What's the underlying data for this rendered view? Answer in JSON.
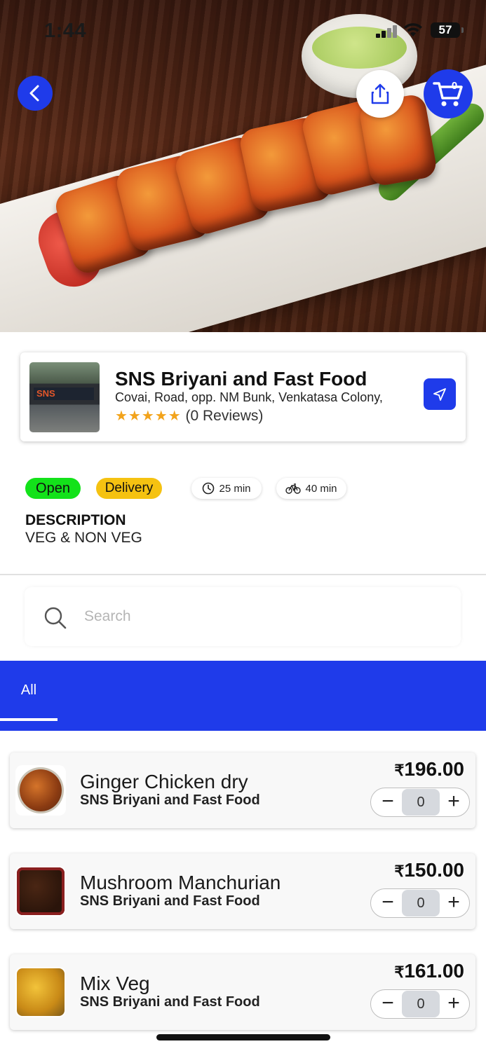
{
  "status": {
    "time": "1:44",
    "battery": "57"
  },
  "header": {
    "cart_count": "0"
  },
  "restaurant": {
    "name": "SNS Briyani and Fast Food",
    "address": "Covai, Road, opp. NM Bunk, Venkatasa Colony,",
    "stars": "★★★★★",
    "reviews": "(0 Reviews)",
    "thumb_sign": "SNS"
  },
  "tags": {
    "open": "Open",
    "delivery": "Delivery",
    "prep_time": "25 min",
    "ride_time": "40 min"
  },
  "description": {
    "title": "DESCRIPTION",
    "text": "VEG & NON VEG"
  },
  "search": {
    "placeholder": "Search"
  },
  "categories": [
    {
      "label": "All",
      "active": true
    }
  ],
  "items": [
    {
      "name": "Ginger Chicken dry",
      "restaurant": "SNS Briyani and Fast Food",
      "currency": "₹",
      "price": "196.00",
      "qty": "0"
    },
    {
      "name": "Mushroom Manchurian",
      "restaurant": "SNS Briyani and Fast Food",
      "currency": "₹",
      "price": "150.00",
      "qty": "0"
    },
    {
      "name": "Mix Veg",
      "restaurant": "SNS Briyani and Fast Food",
      "currency": "₹",
      "price": "161.00",
      "qty": "0"
    }
  ],
  "colors": {
    "primary": "#1f3bea",
    "open": "#13e21a",
    "delivery": "#f5c211",
    "star": "#f2a31b"
  }
}
